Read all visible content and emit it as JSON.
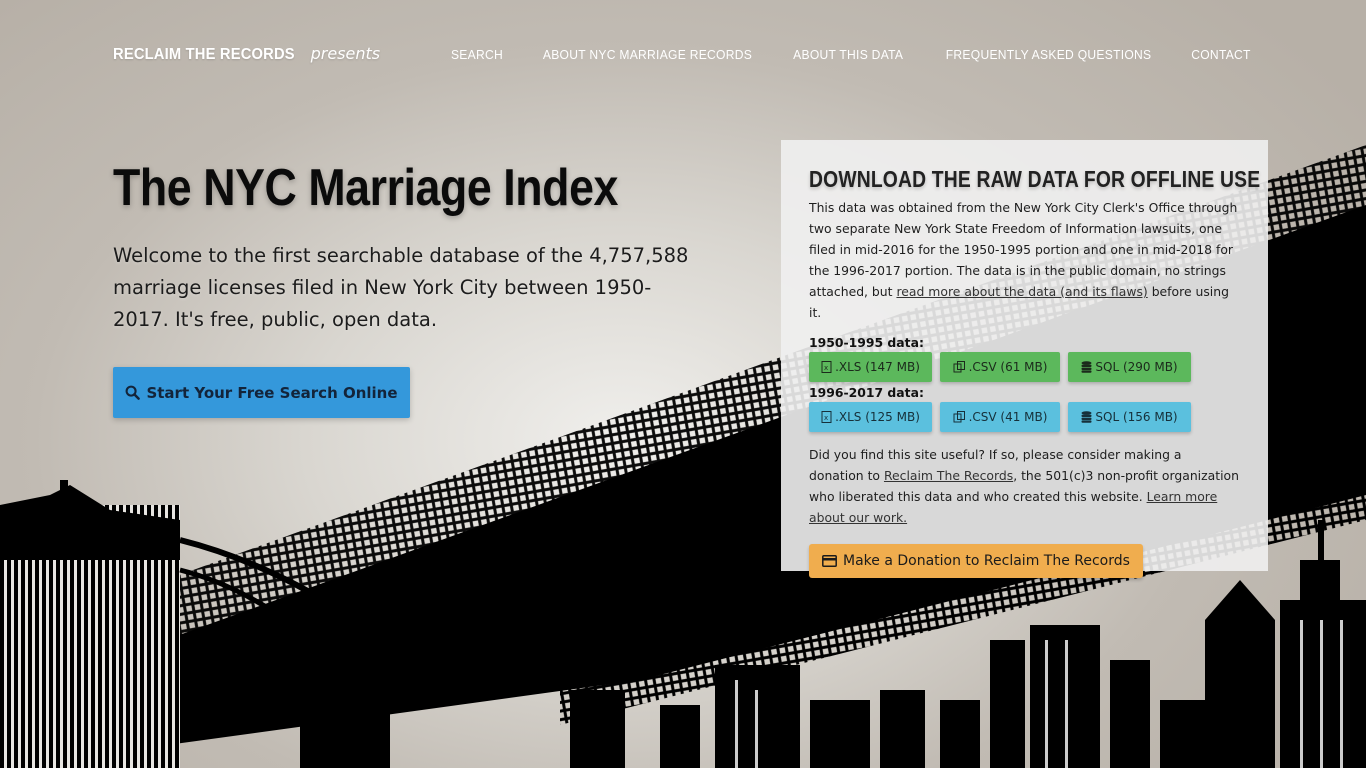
{
  "navbar": {
    "brand_name": "RECLAIM THE RECORDS",
    "brand_sub": "presents",
    "links": [
      {
        "label": "SEARCH"
      },
      {
        "label": "ABOUT NYC MARRIAGE RECORDS"
      },
      {
        "label": "ABOUT THIS DATA"
      },
      {
        "label": "FREQUENTLY ASKED QUESTIONS"
      },
      {
        "label": "CONTACT"
      }
    ]
  },
  "hero": {
    "title": "The NYC Marriage Index",
    "description": "Welcome to the first searchable database of the 4,757,588 marriage licenses filed in New York City between 1950-2017. It's free, public, open data.",
    "search_button": {
      "icon": "search-icon",
      "label": "Start Your Free Search Online"
    }
  },
  "download_panel": {
    "title": "DOWNLOAD THE RAW DATA FOR OFFLINE USE",
    "intro_text": "This data was obtained from the New York City Clerk's Office through two separate New York State Freedom of Information lawsuits, one filed in mid-2016 for the 1950-1995 portion and one in mid-2018 for the 1996-2017 portion. The data is in the public domain, no strings attached, but ",
    "intro_link": "read more about the data (and its flaws)",
    "intro_suffix": " before using it.",
    "ranges": [
      {
        "label": "1950-1995 data:",
        "color": "#5cb85c",
        "buttons": [
          {
            "icon": "file-excel-icon",
            "label": ".XLS (147 MB)"
          },
          {
            "icon": "files-icon",
            "label": ".CSV (61 MB)"
          },
          {
            "icon": "database-icon",
            "label": "SQL (290 MB)"
          }
        ]
      },
      {
        "label": "1996-2017 data:",
        "color": "#5bc0de",
        "buttons": [
          {
            "icon": "file-excel-icon",
            "label": ".XLS (125 MB)"
          },
          {
            "icon": "files-icon",
            "label": ".CSV (41 MB)"
          },
          {
            "icon": "database-icon",
            "label": "SQL (156 MB)"
          }
        ]
      }
    ],
    "donate_text_1": "Did you find this site useful? If so, please consider making a donation to ",
    "donate_link_1": "Reclaim The Records",
    "donate_text_2": ", the 501(c)3 non-profit organization who liberated this data and who created this website. ",
    "donate_link_2": "Learn more about our work.",
    "donate_button": {
      "icon": "credit-card-icon",
      "label": "Make a Donation to Reclaim The Records",
      "color": "#f0ad4e"
    }
  }
}
